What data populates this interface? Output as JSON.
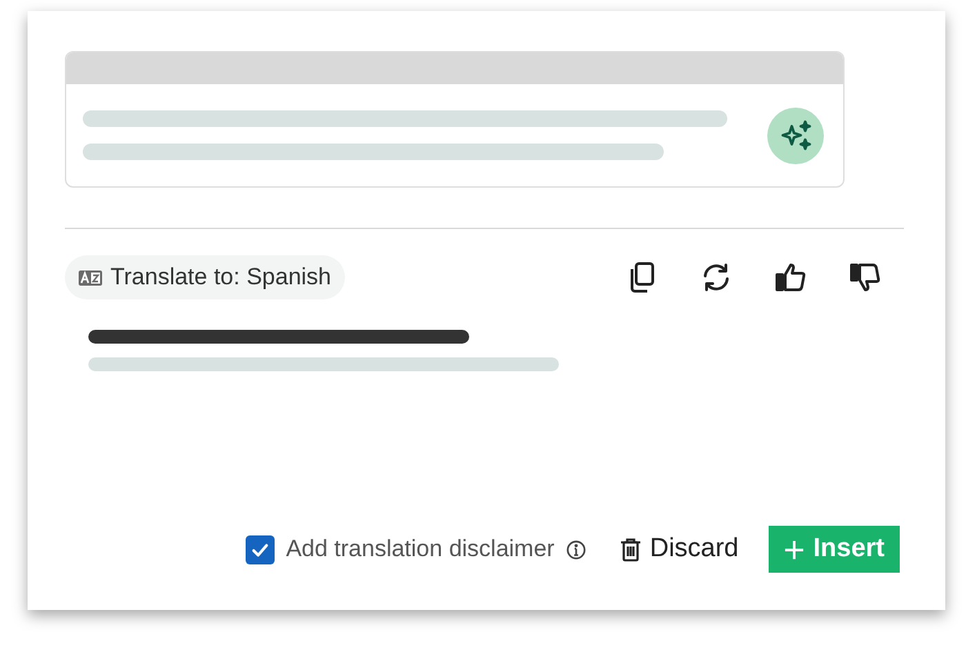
{
  "translate_chip": {
    "label": "Translate to: Spanish"
  },
  "disclaimer": {
    "label": "Add translation disclaimer",
    "checked": true
  },
  "buttons": [
    {
      "kind": "discard",
      "label": "Discard"
    },
    {
      "kind": "insert",
      "label": "Insert"
    }
  ]
}
